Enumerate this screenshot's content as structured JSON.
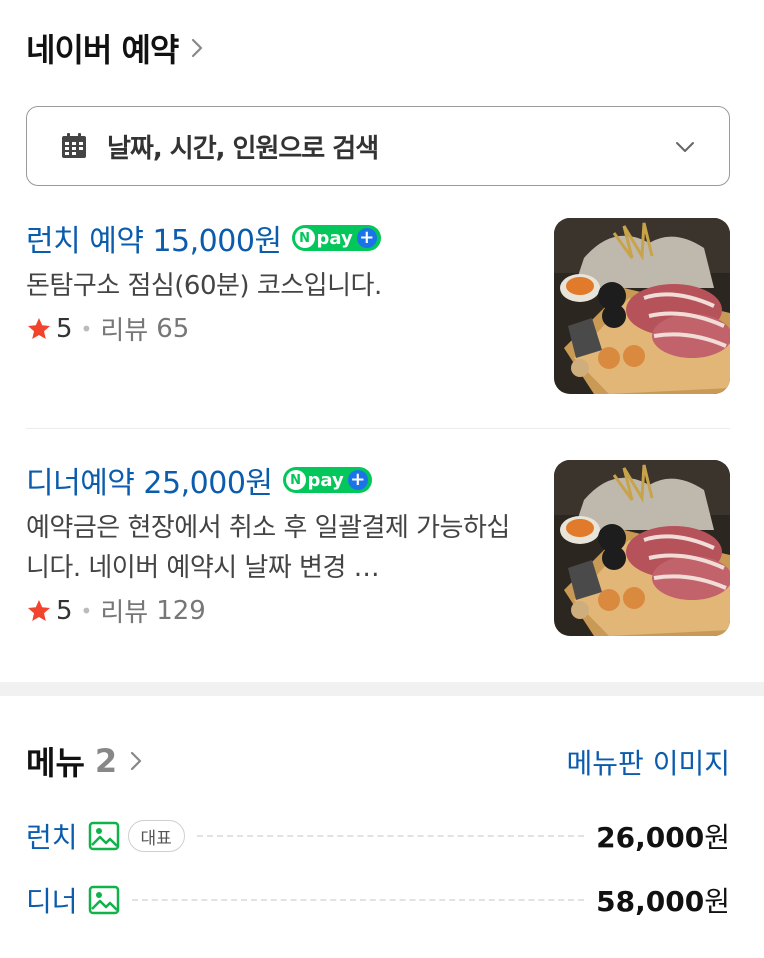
{
  "header": {
    "title": "네이버 예약"
  },
  "search": {
    "label": "날짜, 시간, 인원으로 검색"
  },
  "booking_items": [
    {
      "title": "런치 예약 15,000원",
      "badge": "pay",
      "description": "돈탐구소 점심(60분) 코스입니다.",
      "rating": "5",
      "review_label": "리뷰",
      "review_count": "65"
    },
    {
      "title": "디너예약 25,000원",
      "badge": "pay",
      "description": "예약금은 현장에서 취소 후 일괄결제 가능하십니다. 네이버 예약시 날짜 변경 …",
      "rating": "5",
      "review_label": "리뷰",
      "review_count": "129"
    }
  ],
  "menu": {
    "title": "메뉴",
    "count": "2",
    "image_link": "메뉴판 이미지",
    "items": [
      {
        "name": "런치",
        "badge": "대표",
        "price": "26,000",
        "unit": "원"
      },
      {
        "name": "디너",
        "price": "58,000",
        "unit": "원"
      }
    ]
  },
  "colors": {
    "link_blue": "#0b5cad",
    "npay_green": "#03c75a",
    "star_red": "#f2442d",
    "image_icon_green": "#10b24a"
  },
  "icons": [
    "chevron-right-icon",
    "calendar-icon",
    "chevron-down-icon",
    "npay-logo",
    "star-icon",
    "image-icon"
  ]
}
